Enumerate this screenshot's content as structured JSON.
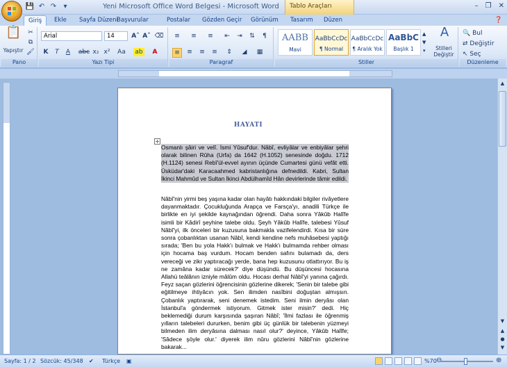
{
  "title": "Yeni Microsoft Office Word Belgesi - Microsoft Word",
  "context_tab": "Tablo Araçları",
  "tabs": [
    "Giriş",
    "Ekle",
    "Sayfa Düzeni",
    "Başvurular",
    "Postalar",
    "Gözden Geçir",
    "Görünüm",
    "Tasarım",
    "Düzen"
  ],
  "ribbon": {
    "clipboard": {
      "paste": "Yapıştır",
      "label": "Pano"
    },
    "font": {
      "name": "Arial",
      "size": "14",
      "label": "Yazı Tipi"
    },
    "paragraph": {
      "label": "Paragraf"
    },
    "styles": {
      "label": "Stiller",
      "items": [
        {
          "preview": "AABB",
          "name": "Mavi"
        },
        {
          "preview": "AaBbCcDc",
          "name": "¶ Normal"
        },
        {
          "preview": "AaBbCcDc",
          "name": "¶ Aralık Yok"
        },
        {
          "preview": "AaBbC",
          "name": "Başlık 1"
        }
      ],
      "change": "Stilleri Değiştir"
    },
    "editing": {
      "label": "Düzenleme",
      "find": "Bul",
      "replace": "Değiştir",
      "select": "Seç"
    }
  },
  "document": {
    "heading": "HAYATI",
    "paragraph1": "Osmanlı şâiri ve velî. İsmi Yûsuf'dur. Nâbî, evliyâlar ve enbiyâlar şehri olarak bilinen Rûha (Urfa) da 1642 (H.1052) senesinde doğdu. 1712 (H.1124) senesi Rebî'ül-evvel ayının üçünde Cumartesi günü vefât etti. Üsküdar'daki Karacaahmed kabristanlığına defnedildi. Kabri, Sultan İkinci Mahmûd ve Sultan İkinci Abdülhamîd Hân devirlerinde tâmir edildi.",
    "paragraph2": "Nâbî'nin yirmi beş yaşına kadar olan hayâtı hakkındaki bilgiler rivâyetlere dayanmaktadır. Çocukluğunda Arapça ve Farsça'yı, anadili Türkçe ile birlikte en iyi şekilde kaynağından öğrendi. Daha sonra Yâkûb Halîfe isimli bir Kâdirî şeyhine talebe oldu. Şeyh Yâkûb Halîfe, talebesi Yûsuf Nâbî'yi, ilk önceleri bir kuzusuna bakmakla vazifelendirdi. Kısa bir süre sonra çobanlıktan usanan Nâbî, kendi kendine nefs muhâsebesi yaptığı sırada; 'Ben bu yola Hakk'ı bulmak ve Hakk'ı bulmamda rehber olması için hocama baş vurdum. Hocam benden safını bulamadı da, ders vereceği ve zikr yaptıracağı yerde, bana hep kuzusunu otlattırıyor. Bu iş ne zamâna kadar sürecek?' diye düşündü. Bu düşüncesi hocasına Allahü teâlânın izniyle mâlûm oldu. Hocası derhal Nâbî'yi yanına çağırdı. Feyz saçan gözlerini öğrencisinin gözlerine dikerek; 'Senin bir talebe gibi eğitilmeye ihtiyâcın yok. Sen ilimden nasîbini doğuştan almışsın. Çobanlık yaptırarak, seni denemek istedim. Seni ilmin deryâsı olan İstanbul'a göndermek istiyorum. Gitmek ister misin?' dedi. Hiç beklemediği durum karşısında şaşıran Nâbî; 'İlmi fazlası ile öğrenmiş yılların talebeleri dururken, benim gibi üç günlük bir talebenin yüzmeyi bilmeden ilim deryâsına dalması nasıl olur?' deyince, Yâkûb Halîfe; 'Sâdece şöyle olur.' diyerek ilim nûru gözlerini Nâbî'nin gözlerine bakarak..."
  },
  "status": {
    "page": "Sayfa: 1 / 2",
    "words": "Sözcük: 45/348",
    "language": "Türkçe",
    "zoom": "%70"
  },
  "colors": {
    "ribbon_bg": "#dbe7f7",
    "highlight": "#c8cbd2",
    "frame": "#9ebbe0"
  }
}
